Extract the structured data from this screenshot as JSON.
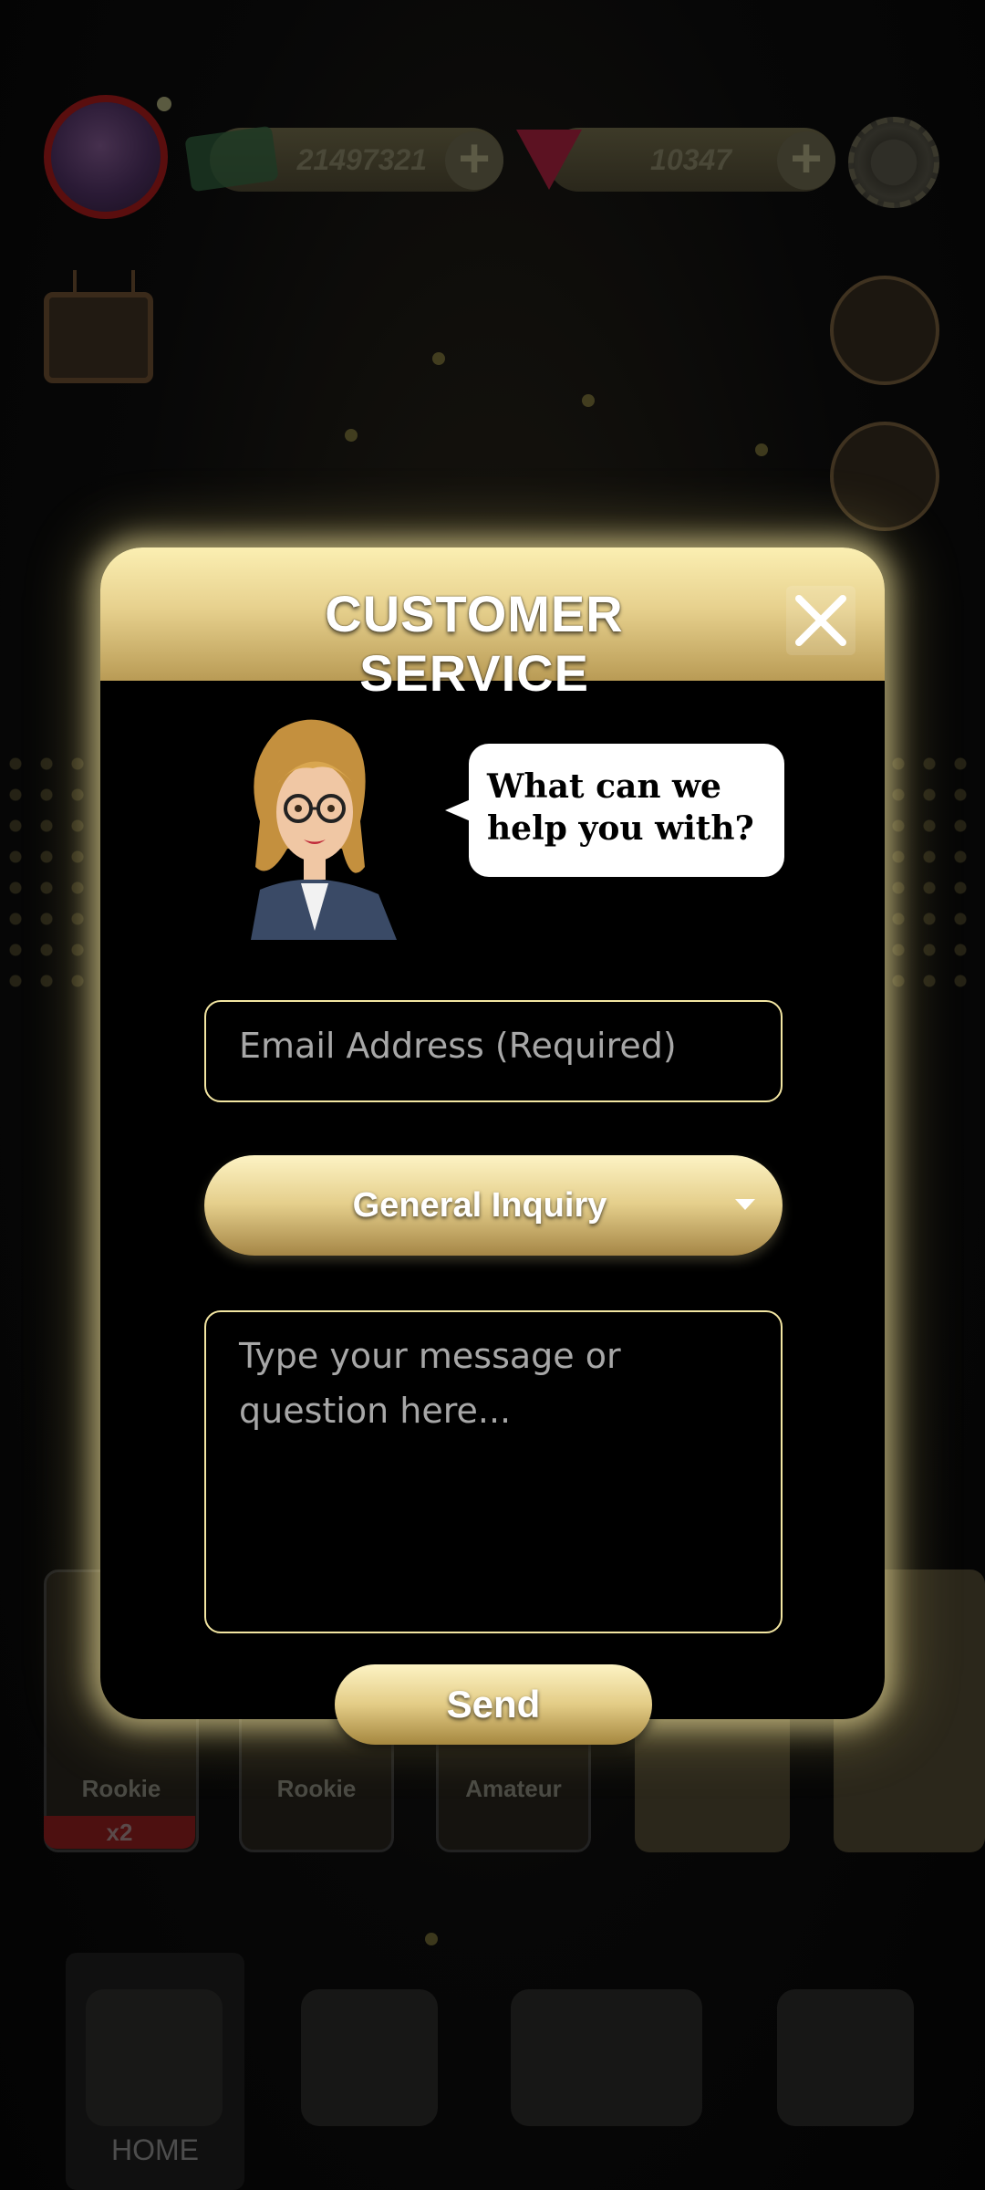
{
  "hud": {
    "coins": "21497321",
    "gems": "10347"
  },
  "cards": [
    {
      "label": "Rookie",
      "badge": "x2"
    },
    {
      "label": "Rookie"
    },
    {
      "label": "Amateur"
    }
  ],
  "nav": {
    "home_label": "HOME"
  },
  "modal": {
    "title": "CUSTOMER SERVICE",
    "bubble_text": "What can we help you with?",
    "email_placeholder": "Email Address (Required)",
    "inquiry_selected": "General Inquiry",
    "message_placeholder": "Type your message or question here...",
    "send_label": "Send"
  },
  "icons": {
    "close": "close-icon",
    "dropdown": "chevron-down-icon",
    "settings": "soccer-ball-gear-icon",
    "coin": "cash-icon",
    "gem": "ruby-gem-icon",
    "plus": "plus-icon",
    "tv": "tv-trophy-icon",
    "coach": "whistle-clipboard-icon",
    "locker": "locker-icon",
    "home": "home-soccer-icon",
    "manager": "manager-icon",
    "trophies": "trophies-icon",
    "shop": "cart-icon"
  },
  "colors": {
    "gold_light": "#fdf3c4",
    "gold_mid": "#e5cf8c",
    "gold_dark": "#a58646",
    "field_border": "#f3e6a2",
    "backdrop": "#050505"
  }
}
